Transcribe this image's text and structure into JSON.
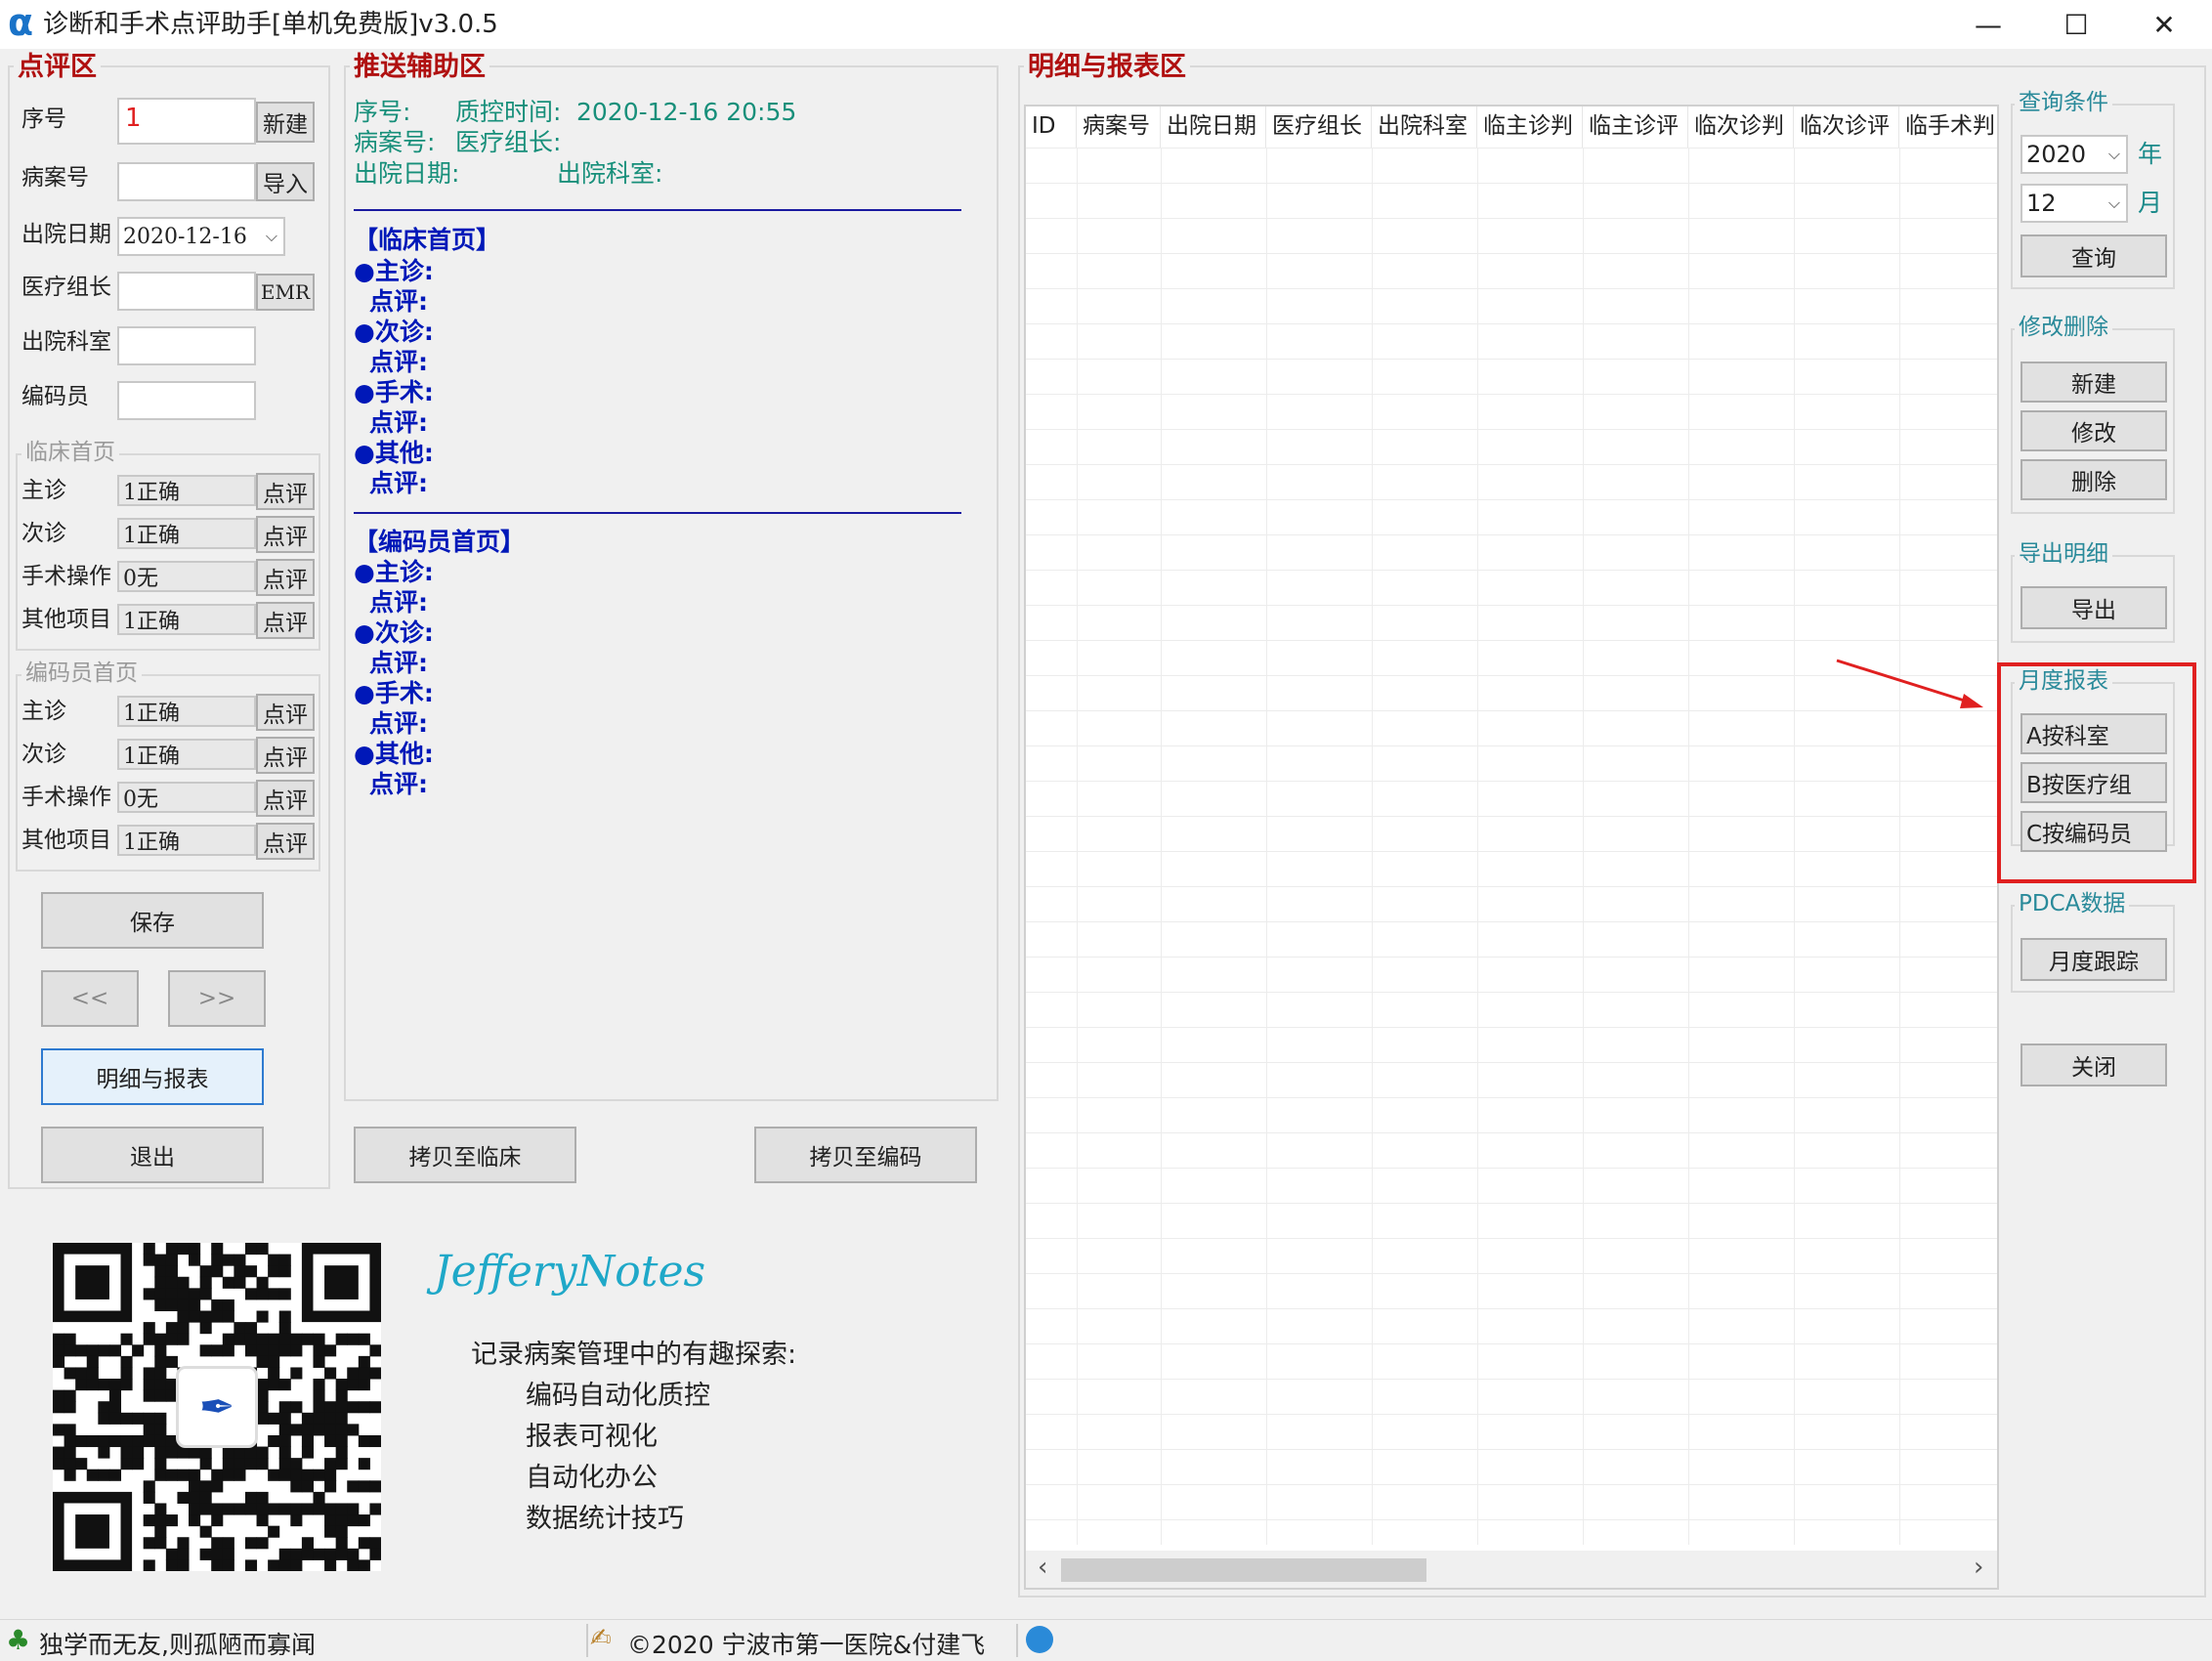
{
  "window": {
    "title": "诊断和手术点评助手[单机免费版]v3.0.5",
    "minimize": "—",
    "maximize": "☐",
    "close": "✕"
  },
  "review": {
    "title": "点评区",
    "seq_label": "序号",
    "seq_value": "1",
    "new_btn": "新建",
    "case_label": "病案号",
    "import_btn": "导入",
    "discharge_label": "出院日期",
    "discharge_value": "2020-12-16",
    "group_label": "医疗组长",
    "emr_btn": "EMR",
    "dept_label": "出院科室",
    "coder_label": "编码员",
    "clinical": {
      "title": "临床首页",
      "rows": [
        {
          "label": "主诊",
          "value": "1正确",
          "btn": "点评"
        },
        {
          "label": "次诊",
          "value": "1正确",
          "btn": "点评"
        },
        {
          "label": "手术操作",
          "value": "0无",
          "btn": "点评"
        },
        {
          "label": "其他项目",
          "value": "1正确",
          "btn": "点评"
        }
      ]
    },
    "coding": {
      "title": "编码员首页",
      "rows": [
        {
          "label": "主诊",
          "value": "1正确",
          "btn": "点评"
        },
        {
          "label": "次诊",
          "value": "1正确",
          "btn": "点评"
        },
        {
          "label": "手术操作",
          "value": "0无",
          "btn": "点评"
        },
        {
          "label": "其他项目",
          "value": "1正确",
          "btn": "点评"
        }
      ]
    },
    "save_btn": "保存",
    "prev_btn": "<<",
    "next_btn": ">>",
    "report_btn": "明细与报表",
    "exit_btn": "退出"
  },
  "push": {
    "title": "推送辅助区",
    "seq_label": "序号:",
    "qc_time_label": "质控时间:",
    "qc_time_value": "2020-12-16 20:55",
    "case_label": "病案号:",
    "leader_label": "医疗组长:",
    "discharge_label": "出院日期:",
    "dept_label": "出院科室:",
    "clinical_title": "【临床首页】",
    "coder_title": "【编码员首页】",
    "items": [
      "●主诊:",
      "点评:",
      "●次诊:",
      "点评:",
      "●手术:",
      "点评:",
      "●其他:",
      "点评:"
    ],
    "copy_clinical_btn": "拷贝至临床",
    "copy_coder_btn": "拷贝至编码"
  },
  "detail": {
    "title": "明细与报表区",
    "columns": [
      "ID",
      "病案号",
      "出院日期",
      "医疗组长",
      "出院科室",
      "临主诊判",
      "临主诊评",
      "临次诊判",
      "临次诊评",
      "临手术判"
    ],
    "scroll_left": "‹",
    "scroll_right": "›"
  },
  "query": {
    "title": "查询条件",
    "year": "2020",
    "year_unit": "年",
    "month": "12",
    "month_unit": "月",
    "btn": "查询"
  },
  "edit": {
    "title": "修改删除",
    "new": "新建",
    "modify": "修改",
    "delete": "删除"
  },
  "export": {
    "title": "导出明细",
    "btn": "导出"
  },
  "monthly": {
    "title": "月度报表",
    "by_dept": "A按科室",
    "by_group": "B按医疗组",
    "by_coder": "C按编码员"
  },
  "pdca": {
    "title": "PDCA数据",
    "btn": "月度跟踪"
  },
  "close_btn": "关闭",
  "promo": {
    "brand": "JefferyNotes",
    "heading": "记录病案管理中的有趣探索:",
    "items": [
      "编码自动化质控",
      "报表可视化",
      "自动化办公",
      "数据统计技巧"
    ]
  },
  "status": {
    "motto": "独学而无友,则孤陋而寡闻",
    "copyright": "©2020 宁波市第一医院&付建飞"
  },
  "colors": {
    "accent_red": "#b01010",
    "push_blue": "#0018b8",
    "push_green": "#178f7a",
    "highlight": "#e02020"
  }
}
